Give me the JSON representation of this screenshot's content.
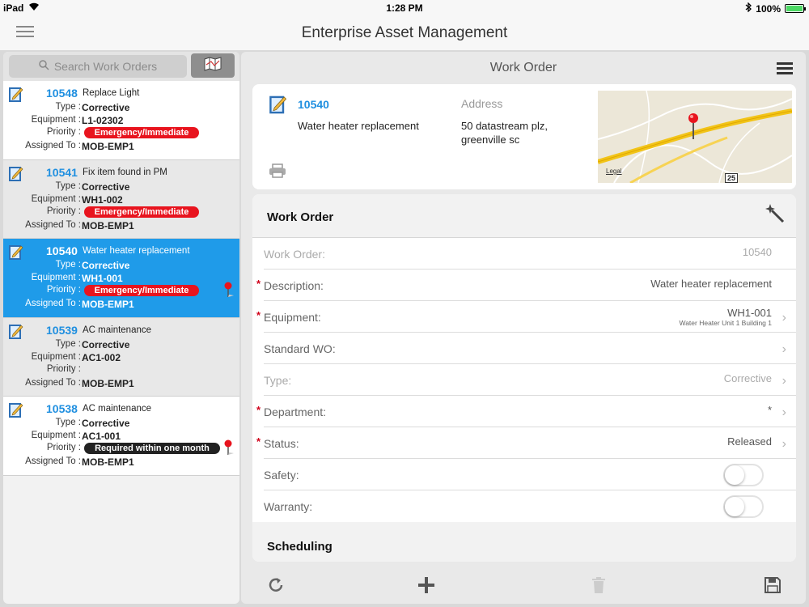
{
  "status_bar": {
    "device": "iPad",
    "time": "1:28 PM",
    "battery": "100%",
    "battery_level": 1.0
  },
  "app": {
    "title": "Enterprise Asset Management"
  },
  "search": {
    "placeholder": "Search Work Orders"
  },
  "labels": {
    "type": "Type :",
    "equipment": "Equipment :",
    "priority": "Priority :",
    "assigned": "Assigned To :"
  },
  "work_orders": [
    {
      "number": "10548",
      "title": "Replace Light",
      "type": "Corrective",
      "equipment": "L1-02302",
      "priority": "Emergency/Immediate",
      "assigned": "MOB-EMP1"
    },
    {
      "number": "10541",
      "title": "Fix item found in PM",
      "type": "Corrective",
      "equipment": "WH1-002",
      "priority": "Emergency/Immediate",
      "assigned": "MOB-EMP1"
    },
    {
      "number": "10540",
      "title": "Water heater replacement",
      "type": "Corrective",
      "equipment": "WH1-001",
      "priority": "Emergency/Immediate",
      "assigned": "MOB-EMP1"
    },
    {
      "number": "10539",
      "title": "AC maintenance",
      "type": "Corrective",
      "equipment": "AC1-002",
      "priority": "",
      "assigned": "MOB-EMP1"
    },
    {
      "number": "10538",
      "title": "AC maintenance",
      "type": "Corrective",
      "equipment": "AC1-001",
      "priority": "Required within one month",
      "assigned": "MOB-EMP1"
    }
  ],
  "detail": {
    "header_title": "Work Order",
    "number": "10540",
    "description": "Water heater replacement",
    "address_label": "Address",
    "address_line1": "50 datastream plz,",
    "address_line2": "greenville sc",
    "map_legal": "Legal",
    "map_marker": "25"
  },
  "form": {
    "title": "Work Order",
    "fields": {
      "work_order_label": "Work Order:",
      "work_order_value": "10540",
      "description_label": "Description:",
      "description_value": "Water heater replacement",
      "equipment_label": "Equipment:",
      "equipment_value": "WH1-001",
      "equipment_sub": "Water Heater Unit 1 Building 1",
      "standard_wo_label": "Standard WO:",
      "type_label": "Type:",
      "type_value": "Corrective",
      "department_label": "Department:",
      "department_value": "*",
      "status_label": "Status:",
      "status_value": "Released",
      "safety_label": "Safety:",
      "warranty_label": "Warranty:"
    },
    "required_mark": "*",
    "scheduling_title": "Scheduling"
  },
  "colors": {
    "accent": "#1f9be9",
    "priority_red": "#e8141e",
    "priority_dark": "#222222",
    "required": "#d0021b"
  }
}
